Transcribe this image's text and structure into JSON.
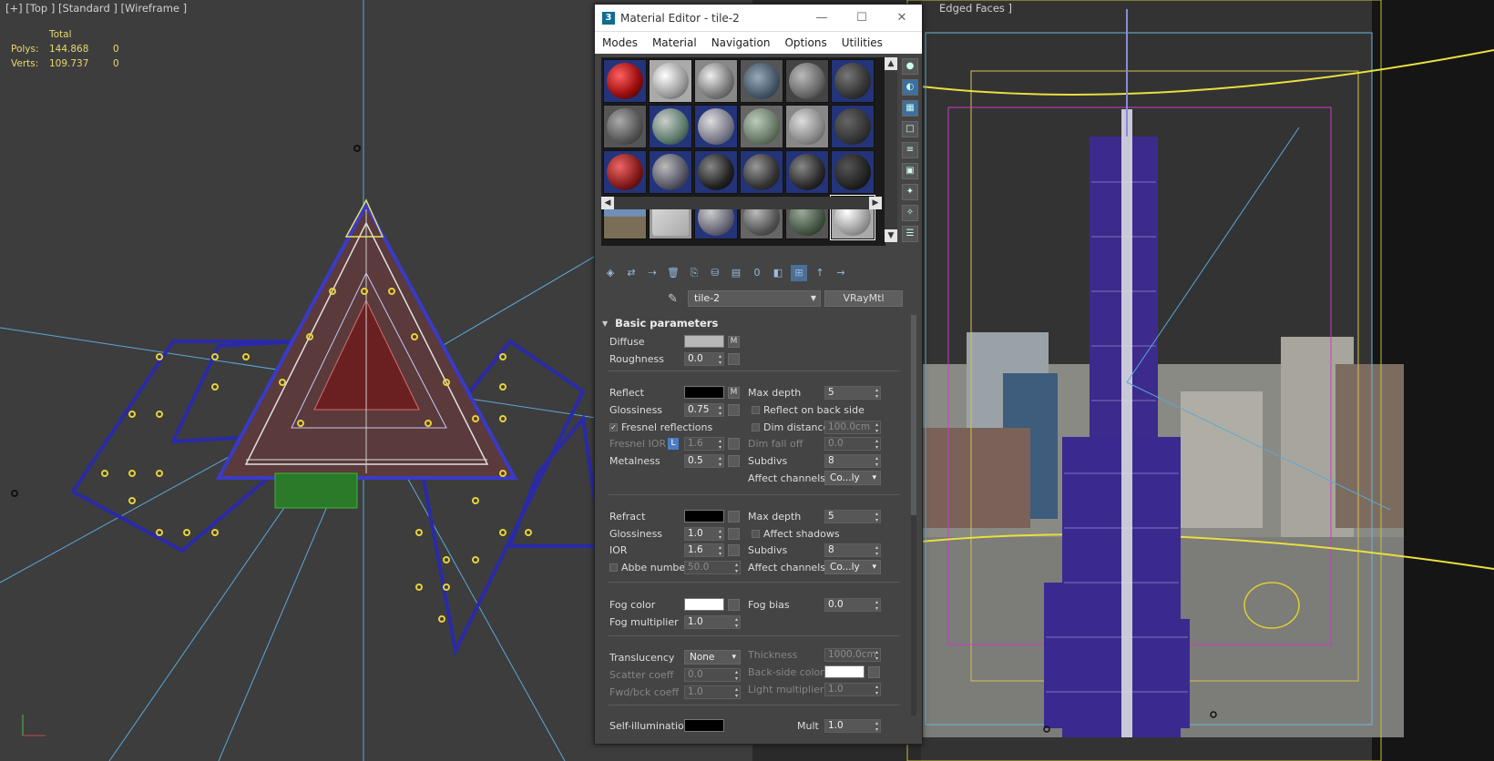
{
  "left_viewport": {
    "label": "[+] [Top ] [Standard ] [Wireframe ]",
    "stats": {
      "header": "Total",
      "rows": [
        {
          "key": "Polys:",
          "total": "144.868",
          "sel": "0"
        },
        {
          "key": "Verts:",
          "total": "109.737",
          "sel": "0"
        }
      ]
    }
  },
  "right_viewport": {
    "label": "Edged Faces ]"
  },
  "material_editor": {
    "title": "Material Editor - tile-2",
    "app_icon": "3",
    "window_buttons": {
      "minimize": "—",
      "maximize": "☐",
      "close": "✕"
    },
    "menu": [
      "Modes",
      "Material",
      "Navigation",
      "Options",
      "Utilities"
    ],
    "material_name": "tile-2",
    "material_type": "VRayMtl",
    "rollout_title": "Basic parameters",
    "diffuse": {
      "label": "Diffuse",
      "color": "#b8b8b8",
      "map": "M"
    },
    "roughness": {
      "label": "Roughness",
      "value": "0.0"
    },
    "reflect": {
      "label": "Reflect",
      "color": "#000000",
      "map": "M"
    },
    "glossiness": {
      "label": "Glossiness",
      "value": "0.75"
    },
    "fresnel": {
      "label": "Fresnel reflections",
      "checked": "✓"
    },
    "fresnel_ior": {
      "label": "Fresnel IOR",
      "lock": "L",
      "value": "1.6"
    },
    "metalness": {
      "label": "Metalness",
      "value": "0.5"
    },
    "refl_max_depth": {
      "label": "Max depth",
      "value": "5"
    },
    "reflect_back": {
      "label": "Reflect on back side"
    },
    "dim_distance": {
      "label": "Dim distance",
      "value": "100.0cm"
    },
    "dim_falloff": {
      "label": "Dim fall off",
      "value": "0.0"
    },
    "refl_subdivs": {
      "label": "Subdivs",
      "value": "8"
    },
    "refl_affect": {
      "label": "Affect channels",
      "value": "Co...ly"
    },
    "refract": {
      "label": "Refract",
      "color": "#000000"
    },
    "refr_glossiness": {
      "label": "Glossiness",
      "value": "1.0"
    },
    "ior": {
      "label": "IOR",
      "value": "1.6"
    },
    "abbe": {
      "label": "Abbe number",
      "value": "50.0"
    },
    "refr_max_depth": {
      "label": "Max depth",
      "value": "5"
    },
    "affect_shadows": {
      "label": "Affect shadows"
    },
    "refr_subdivs": {
      "label": "Subdivs",
      "value": "8"
    },
    "refr_affect": {
      "label": "Affect channels",
      "value": "Co...ly"
    },
    "fog_color": {
      "label": "Fog color",
      "color": "#ffffff"
    },
    "fog_multiplier": {
      "label": "Fog multiplier",
      "value": "1.0"
    },
    "fog_bias": {
      "label": "Fog bias",
      "value": "0.0"
    },
    "translucency": {
      "label": "Translucency",
      "value": "None"
    },
    "scatter": {
      "label": "Scatter coeff",
      "value": "0.0"
    },
    "fwdbck": {
      "label": "Fwd/bck coeff",
      "value": "1.0"
    },
    "thickness": {
      "label": "Thickness",
      "value": "1000.0cm"
    },
    "backside": {
      "label": "Back-side color",
      "color": "#ffffff"
    },
    "light_mult": {
      "label": "Light multiplier",
      "value": "1.0"
    },
    "self_illum": {
      "label": "Self-illumination",
      "color": "#000000"
    },
    "mult": {
      "label": "Mult",
      "value": "1.0"
    }
  }
}
